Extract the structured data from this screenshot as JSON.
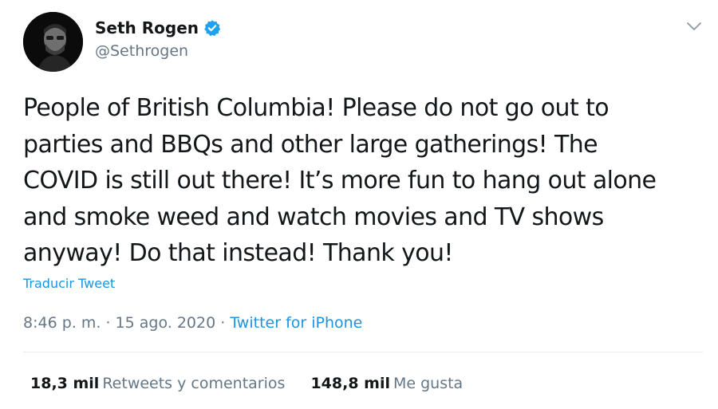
{
  "user": {
    "display_name": "Seth Rogen",
    "handle": "@Sethrogen",
    "verified": true
  },
  "icons": {
    "verified": "verified-badge-icon",
    "caret": "chevron-down-icon"
  },
  "tweet": {
    "text_lines": [
      "People of British Columbia! Please do not go out to",
      "parties and BBQs and other large gatherings! The",
      "COVID is still out there! It’s more fun to hang out alone",
      "and smoke weed and watch movies and TV shows",
      "anyway! Do that instead! Thank you!"
    ],
    "translate_label": "Traducir Tweet",
    "time": "8:46 p. m.",
    "separator": "·",
    "date": "15 ago. 2020",
    "source": "Twitter for iPhone"
  },
  "stats": {
    "retweets_count": "18,3 mil",
    "retweets_label": "Retweets y comentarios",
    "likes_count": "148,8 mil",
    "likes_label": "Me gusta"
  },
  "colors": {
    "accent": "#1b95e0",
    "text": "#14171a",
    "secondary": "#657786",
    "divider": "#e6ecf0"
  }
}
